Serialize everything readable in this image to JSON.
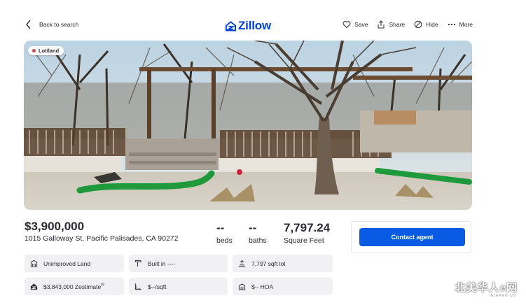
{
  "header": {
    "back_label": "Back to search",
    "logo_text": "Zillow",
    "actions": [
      {
        "label": "Save",
        "icon": "heart-icon"
      },
      {
        "label": "Share",
        "icon": "share-icon"
      },
      {
        "label": "Hide",
        "icon": "hide-icon"
      },
      {
        "label": "More",
        "icon": "more-icon"
      }
    ]
  },
  "photo": {
    "status": "Lot/land",
    "status_color": "#d64545"
  },
  "summary": {
    "price": "$3,900,000",
    "address": "1015 Galloway St, Pacific Palisades, CA 90272",
    "beds": {
      "value": "--",
      "label": "beds"
    },
    "baths": {
      "value": "--",
      "label": "baths"
    },
    "sqft": {
      "value": "7,797.24",
      "label": "Square Feet"
    }
  },
  "contact": {
    "button_label": "Contact agent"
  },
  "facts": [
    {
      "icon": "land-icon",
      "text": "Unimproved Land"
    },
    {
      "icon": "hammer-icon",
      "text": "Built in ----"
    },
    {
      "icon": "lot-icon",
      "text": "7,797 sqft lot"
    },
    {
      "icon": "zestimate-icon",
      "text": "$3,843,000 Zestimate",
      "sup": "®"
    },
    {
      "icon": "ruler-icon",
      "text": "$--/sqft"
    },
    {
      "icon": "hoa-icon",
      "text": "$-- HOA"
    }
  ],
  "watermark": {
    "text": "北美华人e网",
    "sub": "HUAREN.US"
  },
  "colors": {
    "brand": "#0041d9",
    "button": "#0a5be3",
    "fact_bg": "#f1f1f4"
  }
}
